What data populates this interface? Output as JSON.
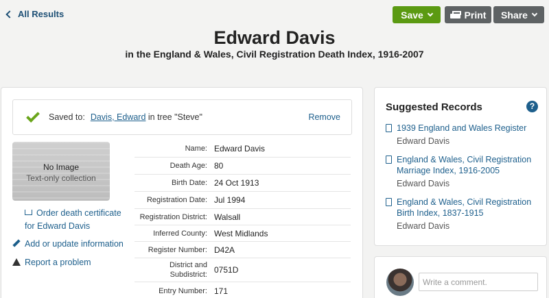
{
  "nav": {
    "back_label": "All Results"
  },
  "toolbar": {
    "save_label": "Save",
    "print_label": "Print",
    "share_label": "Share"
  },
  "record": {
    "name": "Edward Davis",
    "collection": "in the England & Wales, Civil Registration Death Index, 1916-2007"
  },
  "saved": {
    "label": "Saved to:",
    "person_link": "Davis, Edward",
    "tree_text": " in tree \"Steve\"",
    "remove_label": "Remove"
  },
  "image": {
    "title": "No Image",
    "subtitle": "Text-only collection"
  },
  "actions": {
    "order": "Order death certificate for Edward Davis",
    "add": "Add or update information",
    "report": "Report a problem"
  },
  "facts": [
    {
      "label": "Name:",
      "value": "Edward Davis"
    },
    {
      "label": "Death Age:",
      "value": "80"
    },
    {
      "label": "Birth Date:",
      "value": "24 Oct 1913"
    },
    {
      "label": "Registration Date:",
      "value": "Jul 1994"
    },
    {
      "label": "Registration District:",
      "value": "Walsall"
    },
    {
      "label": "Inferred County:",
      "value": "West Midlands"
    },
    {
      "label": "Register Number:",
      "value": "D42A"
    },
    {
      "label": "District and Subdistrict:",
      "value": "0751D"
    },
    {
      "label": "Entry Number:",
      "value": "171"
    }
  ],
  "suggested": {
    "title": "Suggested Records",
    "help": "?",
    "items": [
      {
        "title": "1939 England and Wales Register",
        "name": "Edward Davis"
      },
      {
        "title": "England & Wales, Civil Registration Marriage Index, 1916-2005",
        "name": "Edward Davis"
      },
      {
        "title": "England & Wales, Civil Registration Birth Index, 1837-1915",
        "name": "Edward Davis"
      }
    ]
  },
  "comment": {
    "placeholder": "Write a comment."
  },
  "colors": {
    "save_green": "#5b9a12",
    "link_blue": "#1d5f8c",
    "dark_button": "#5e6264"
  },
  "icons": [
    "chevron-left-icon",
    "chevron-down-icon",
    "printer-icon",
    "checkmark-icon",
    "cart-icon",
    "pencil-icon",
    "warning-icon",
    "document-icon",
    "help-icon"
  ]
}
